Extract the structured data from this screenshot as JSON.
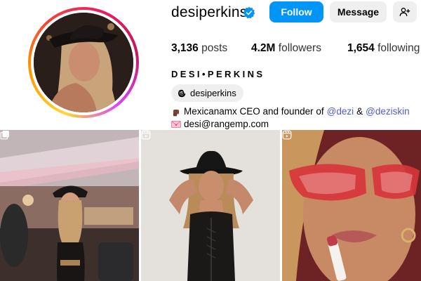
{
  "profile": {
    "username": "desiperkins",
    "verified": true,
    "full_name": "DESI•PERKINS",
    "threads_handle": "desiperkins",
    "follow_label": "Follow",
    "message_label": "Message",
    "stats": {
      "posts_count": "3,136",
      "posts_label": "posts",
      "followers_count": "4.2M",
      "followers_label": "followers",
      "following_count": "1,654",
      "following_label": "following"
    },
    "bio": {
      "line1_text": "Mexicanamx CEO and founder of",
      "mention_1": "@dezi",
      "ampersand": "&",
      "mention_2": "@deziskin",
      "email": "desi@rangemp.com"
    }
  },
  "posts": [
    {
      "type": "carousel",
      "icon": "carousel-icon"
    },
    {
      "type": "reel",
      "icon": "reel-icon"
    },
    {
      "type": "reel",
      "icon": "reel-icon"
    }
  ],
  "colors": {
    "follow_button": "#0095f6",
    "secondary_button": "#efefef",
    "mention": "#4f5bd5",
    "verified_badge": "#0095f6"
  }
}
